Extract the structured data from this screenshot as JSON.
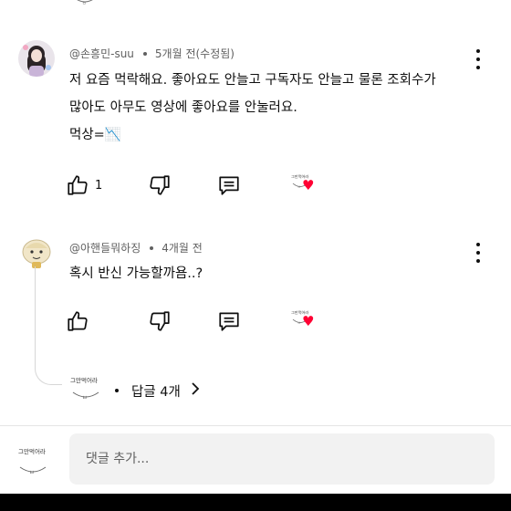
{
  "comments": [
    {
      "author": "@손흥민-suu",
      "time": "5개월 전(수정됨)",
      "lines": [
        "저 요즘 먹락해요. 좋아요도 안늘고 구독자도 안늘고 물론 조회수가",
        "많아도 아무도 영상에 좋아요를 안눌러요.",
        "먹상=📉"
      ],
      "like_count": "1",
      "creator_heart_text": "그만먹어라"
    },
    {
      "author": "@아핸들뭐하징",
      "time": "4개월 전",
      "lines": [
        "혹시 반신 가능할까욤..?"
      ],
      "like_count": "",
      "creator_heart_text": "그만먹어라"
    }
  ],
  "replies": {
    "avatar_text": "그만먹어라",
    "label": "답글 4개"
  },
  "compose": {
    "avatar_text": "그만먹어라",
    "placeholder": "댓글 추가..."
  },
  "icons": {
    "like": "thumbs-up-icon",
    "dislike": "thumbs-down-icon",
    "reply": "comment-bubble-icon",
    "more": "more-vertical-icon",
    "heart": "heart-icon",
    "chevron": "chevron-right-icon"
  },
  "colors": {
    "heart": "#ff0033",
    "text": "#0f0f0f",
    "meta": "#606060",
    "input_bg": "#f2f2f2"
  }
}
